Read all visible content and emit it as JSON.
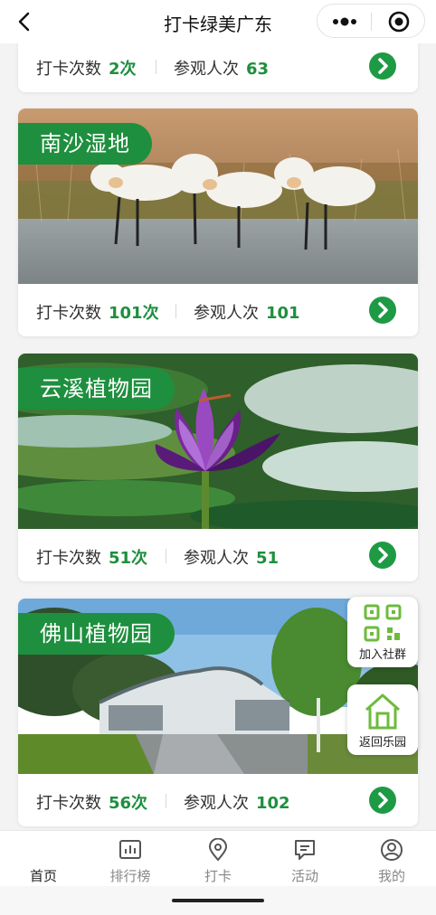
{
  "nav": {
    "title": "打卡绿美广东"
  },
  "stat_labels": {
    "checkins": "打卡次数",
    "visitors": "参观人次"
  },
  "cards": [
    {
      "name": "",
      "checkins": "2次",
      "visitors": "63"
    },
    {
      "name": "南沙湿地",
      "checkins": "101次",
      "visitors": "101"
    },
    {
      "name": "云溪植物园",
      "checkins": "51次",
      "visitors": "51"
    },
    {
      "name": "佛山植物园",
      "checkins": "56次",
      "visitors": "102"
    }
  ],
  "floating": {
    "join_group": "加入社群",
    "back_to_park": "返回乐园"
  },
  "tabs": [
    {
      "label": "首页",
      "icon": "home-icon",
      "active": true
    },
    {
      "label": "排行榜",
      "icon": "ranking-icon"
    },
    {
      "label": "打卡",
      "icon": "location-pin-icon"
    },
    {
      "label": "活动",
      "icon": "message-icon"
    },
    {
      "label": "我的",
      "icon": "user-icon"
    }
  ],
  "colors": {
    "accent": "#1e8f3e",
    "background": "#f3f3f3"
  }
}
